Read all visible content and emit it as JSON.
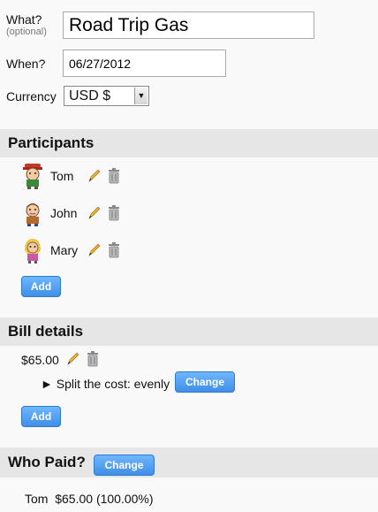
{
  "form": {
    "what_label": "What?",
    "what_sub": "(optional)",
    "what_value": "Road Trip Gas",
    "when_label": "When?",
    "when_value": "06/27/2012",
    "currency_label": "Currency",
    "currency_value": "USD $"
  },
  "participants": {
    "title": "Participants",
    "people": [
      {
        "name": "Tom"
      },
      {
        "name": "John"
      },
      {
        "name": "Mary"
      }
    ],
    "add_label": "Add"
  },
  "bill": {
    "title": "Bill details",
    "amount": "$65.00",
    "split_text": "► Split the cost: evenly",
    "change_label": "Change",
    "add_label": "Add"
  },
  "who_paid": {
    "title": "Who Paid?",
    "change_label": "Change",
    "payer_text": "Tom  $65.00 (100.00%)"
  },
  "icons": {
    "edit": "pencil-icon",
    "delete": "trash-icon",
    "dropdown": "chevron-down-icon"
  }
}
